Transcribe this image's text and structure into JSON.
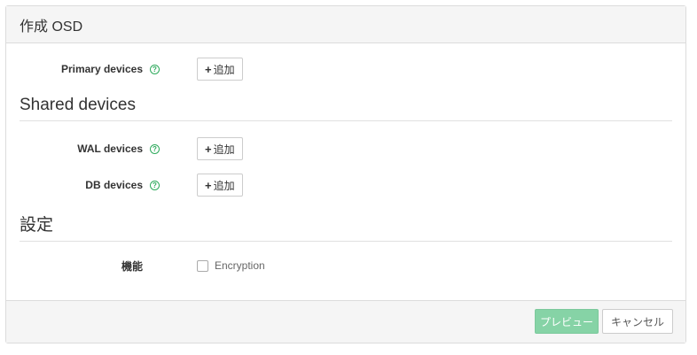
{
  "header": {
    "title": "作成 OSD"
  },
  "primary": {
    "label": "Primary devices",
    "help_icon": "question-circle-icon",
    "add_label": "追加"
  },
  "shared_section": {
    "title": "Shared devices"
  },
  "wal": {
    "label": "WAL devices",
    "help_icon": "question-circle-icon",
    "add_label": "追加"
  },
  "db": {
    "label": "DB devices",
    "help_icon": "question-circle-icon",
    "add_label": "追加"
  },
  "settings_section": {
    "title": "設定"
  },
  "features": {
    "label": "機能",
    "encryption_label": "Encryption",
    "encryption_checked": false
  },
  "footer": {
    "preview_label": "プレビュー",
    "cancel_label": "キャンセル"
  },
  "colors": {
    "accent_green": "#2eaa5c",
    "preview_button": "#86d3a6"
  }
}
